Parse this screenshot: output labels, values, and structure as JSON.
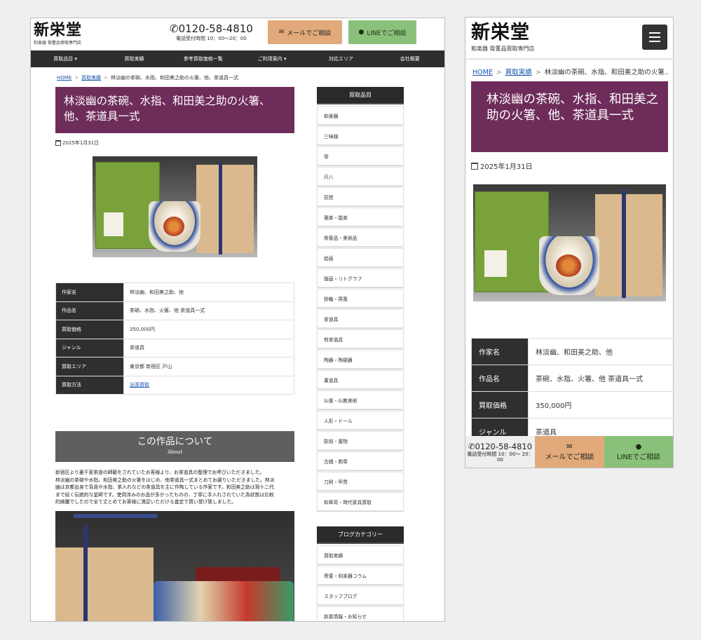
{
  "site": {
    "logo_text": "新栄堂",
    "logo_sub": "和楽器 骨董品買取専門店",
    "phone": "0120-58-4810",
    "hours": "電話受付時間 10：00〜20：00",
    "hours_mobile": "電話受付時間 10：00〜 20：00",
    "mail_label": "メールでご相談",
    "line_label": "LINEでご相談"
  },
  "nav": [
    "買取品目 ▾",
    "買取実績",
    "参考買取価格一覧",
    "ご利用案内 ▾",
    "対応エリア",
    "会社概要"
  ],
  "breadcrumb": {
    "home": "HOME",
    "sep": ">",
    "category": "買取実績",
    "current": "林淡幽の茶碗、水指、和田美之助の火箸、他、茶道具一式",
    "current_mobile": "林淡幽の茶碗、水指、和田美之助の火箸..."
  },
  "post": {
    "title": "林淡幽の茶碗、水指、和田美之助の火箸、他、茶道具一式",
    "date": "2025年1月31日"
  },
  "details": [
    {
      "key": "作家名",
      "value": "林淡幽、和田美之助、他"
    },
    {
      "key": "作品名",
      "value": "茶碗、水指、火箸、他 茶道具一式"
    },
    {
      "key": "買取価格",
      "value": "350,000円"
    },
    {
      "key": "ジャンル",
      "value": "茶道具"
    },
    {
      "key": "買取エリア",
      "value": "東京都 新宿区 戸山"
    },
    {
      "key": "買取方法",
      "value": "出張買取"
    }
  ],
  "about": {
    "title": "この作品について",
    "sub": "About",
    "lines": [
      "新宿区より裏千家茶道の師範をされていたお客様より、お茶道具の整理でお呼びいただきました。",
      "林淡幽の茶碗や水指、和田美之助の火箸をはじめ、他茶道具一式まとめてお譲りいただきました。林淡",
      "幽は京都出身で背員や水指、茶入れなどの茶道具を主に作陶している作家です。和田美之助は現十二代",
      "まで続く伝統的な釜師です。使用済みのお品が多かったものの、丁寧に手入れされていた為状態は比較",
      "的綺麗でしたので全て丈とめてお客様に満足いただける査定で買い受け致しました。"
    ]
  },
  "sidebar": {
    "heading": "買取品目",
    "items": [
      "和楽器",
      "三味線",
      "琴",
      "尺八",
      "琵琶",
      "雅楽・能楽",
      "骨董品・美術品",
      "絵画",
      "版画・リトグラフ",
      "掛軸・屏風",
      "茶道具",
      "煎茶道具",
      "陶器・陶磁器",
      "書道具",
      "仏像・仏教美術",
      "人形・ドール",
      "彫刻・置物",
      "古銭・勲章",
      "刀剣・甲冑",
      "和箪笥・時代家具買取"
    ],
    "blog_heading": "ブログカテゴリー",
    "blog_items": [
      "買取実績",
      "骨董・和楽器コラム",
      "スタッフブログ",
      "新着情報・お知らせ"
    ]
  }
}
